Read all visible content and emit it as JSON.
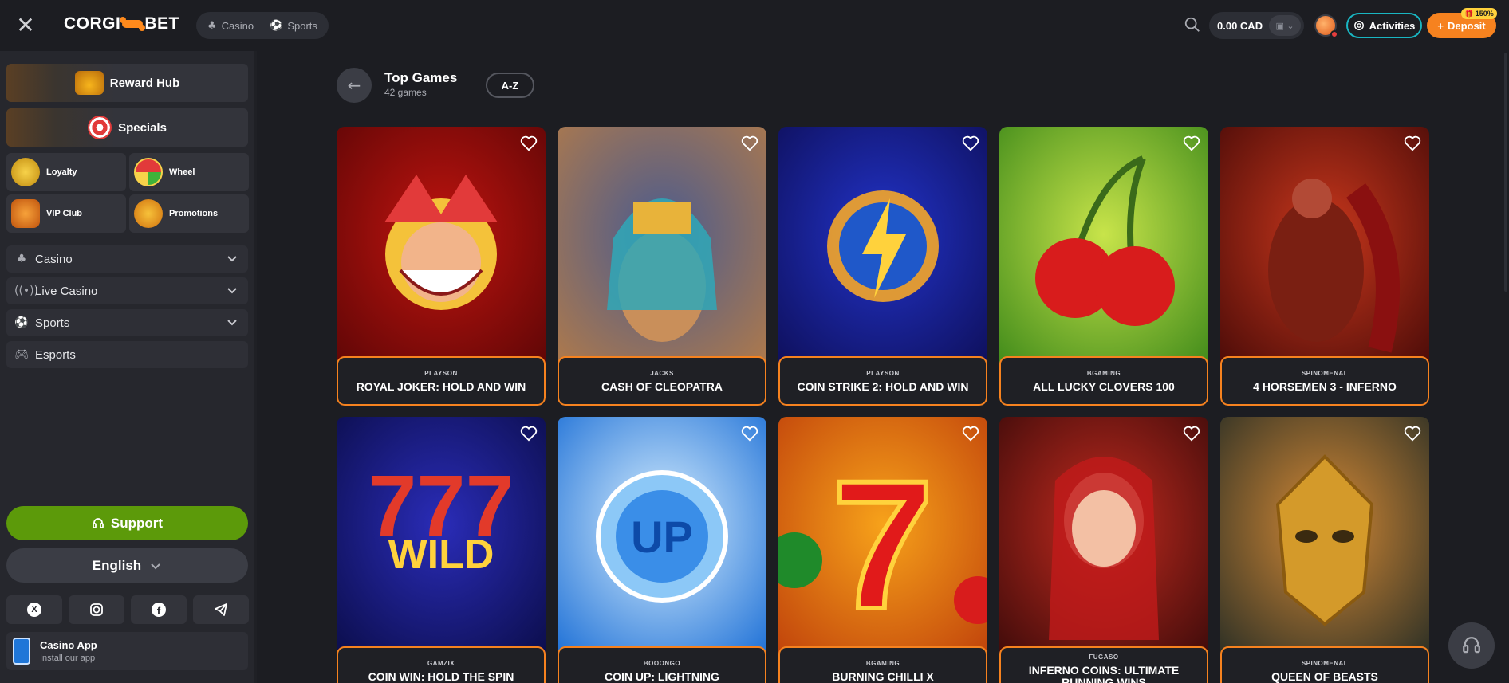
{
  "header": {
    "logo_left": "CORGI",
    "logo_right": "BET",
    "tabs": [
      {
        "label": "Casino",
        "icon": "casino-icon"
      },
      {
        "label": "Sports",
        "icon": "sports-icon"
      }
    ],
    "balance": "0.00 CAD",
    "activities_label": "Activities",
    "deposit_label": "Deposit",
    "deposit_badge": "150%"
  },
  "sidebar": {
    "reward_hub": "Reward Hub",
    "specials": "Specials",
    "tiles": [
      {
        "label": "Loyalty"
      },
      {
        "label": "Wheel"
      },
      {
        "label": "VIP Club"
      },
      {
        "label": "Promotions"
      }
    ],
    "nav": [
      {
        "label": "Casino",
        "icon": "casino-icon"
      },
      {
        "label": "Live Casino",
        "icon": "live-icon"
      },
      {
        "label": "Sports",
        "icon": "soccer-ball-icon"
      },
      {
        "label": "Esports",
        "icon": "gamepad-icon"
      }
    ],
    "support_label": "Support",
    "language": "English",
    "socials": [
      "x-icon",
      "instagram-icon",
      "facebook-icon",
      "telegram-icon"
    ],
    "app_title": "Casino App",
    "app_subtitle": "Install our app"
  },
  "main": {
    "title": "Top Games",
    "count": "42 games",
    "sort_label": "A-Z",
    "games": [
      {
        "provider": "PLAYSON",
        "name": "ROYAL JOKER: HOLD AND WIN",
        "bg1": "#c0140f",
        "bg2": "#5e0606",
        "motif": "joker"
      },
      {
        "provider": "JACKS",
        "name": "CASH OF CLEOPATRA",
        "bg1": "#4a5b8f",
        "bg2": "#b07a4a",
        "motif": "cleopatra"
      },
      {
        "provider": "PLAYSON",
        "name": "COIN STRIKE 2: HOLD AND WIN",
        "bg1": "#2233c9",
        "bg2": "#0e0f5a",
        "motif": "bolt"
      },
      {
        "provider": "BGAMING",
        "name": "ALL LUCKY CLOVERS 100",
        "bg1": "#c8e44a",
        "bg2": "#3f8a1a",
        "motif": "cherries"
      },
      {
        "provider": "SPINOMENAL",
        "name": "4 HORSEMEN 3 - INFERNO",
        "bg1": "#c9371c",
        "bg2": "#4a0b08",
        "motif": "horseman"
      },
      {
        "provider": "GAMZIX",
        "name": "COIN WIN: HOLD THE SPIN",
        "bg1": "#2a2cb8",
        "bg2": "#0b0d4a",
        "motif": "wild"
      },
      {
        "provider": "BOOONGO",
        "name": "COIN UP: LIGHTNING",
        "bg1": "#d9f0ff",
        "bg2": "#1c6fd6",
        "motif": "up"
      },
      {
        "provider": "BGAMING",
        "name": "BURNING CHILLI X",
        "bg1": "#f7a21a",
        "bg2": "#c0420b",
        "motif": "seven"
      },
      {
        "provider": "FUGASO",
        "name": "INFERNO COINS: ULTIMATE RUNNING WINS",
        "bg1": "#c42b1f",
        "bg2": "#3e0b0a",
        "motif": "lady"
      },
      {
        "provider": "SPINOMENAL",
        "name": "QUEEN OF BEASTS",
        "bg1": "#d68a35",
        "bg2": "#2b2f25",
        "motif": "mask"
      }
    ]
  },
  "colors": {
    "accent": "#f6821f",
    "support": "#5c9a0a",
    "activities_border": "#19b6c2"
  }
}
